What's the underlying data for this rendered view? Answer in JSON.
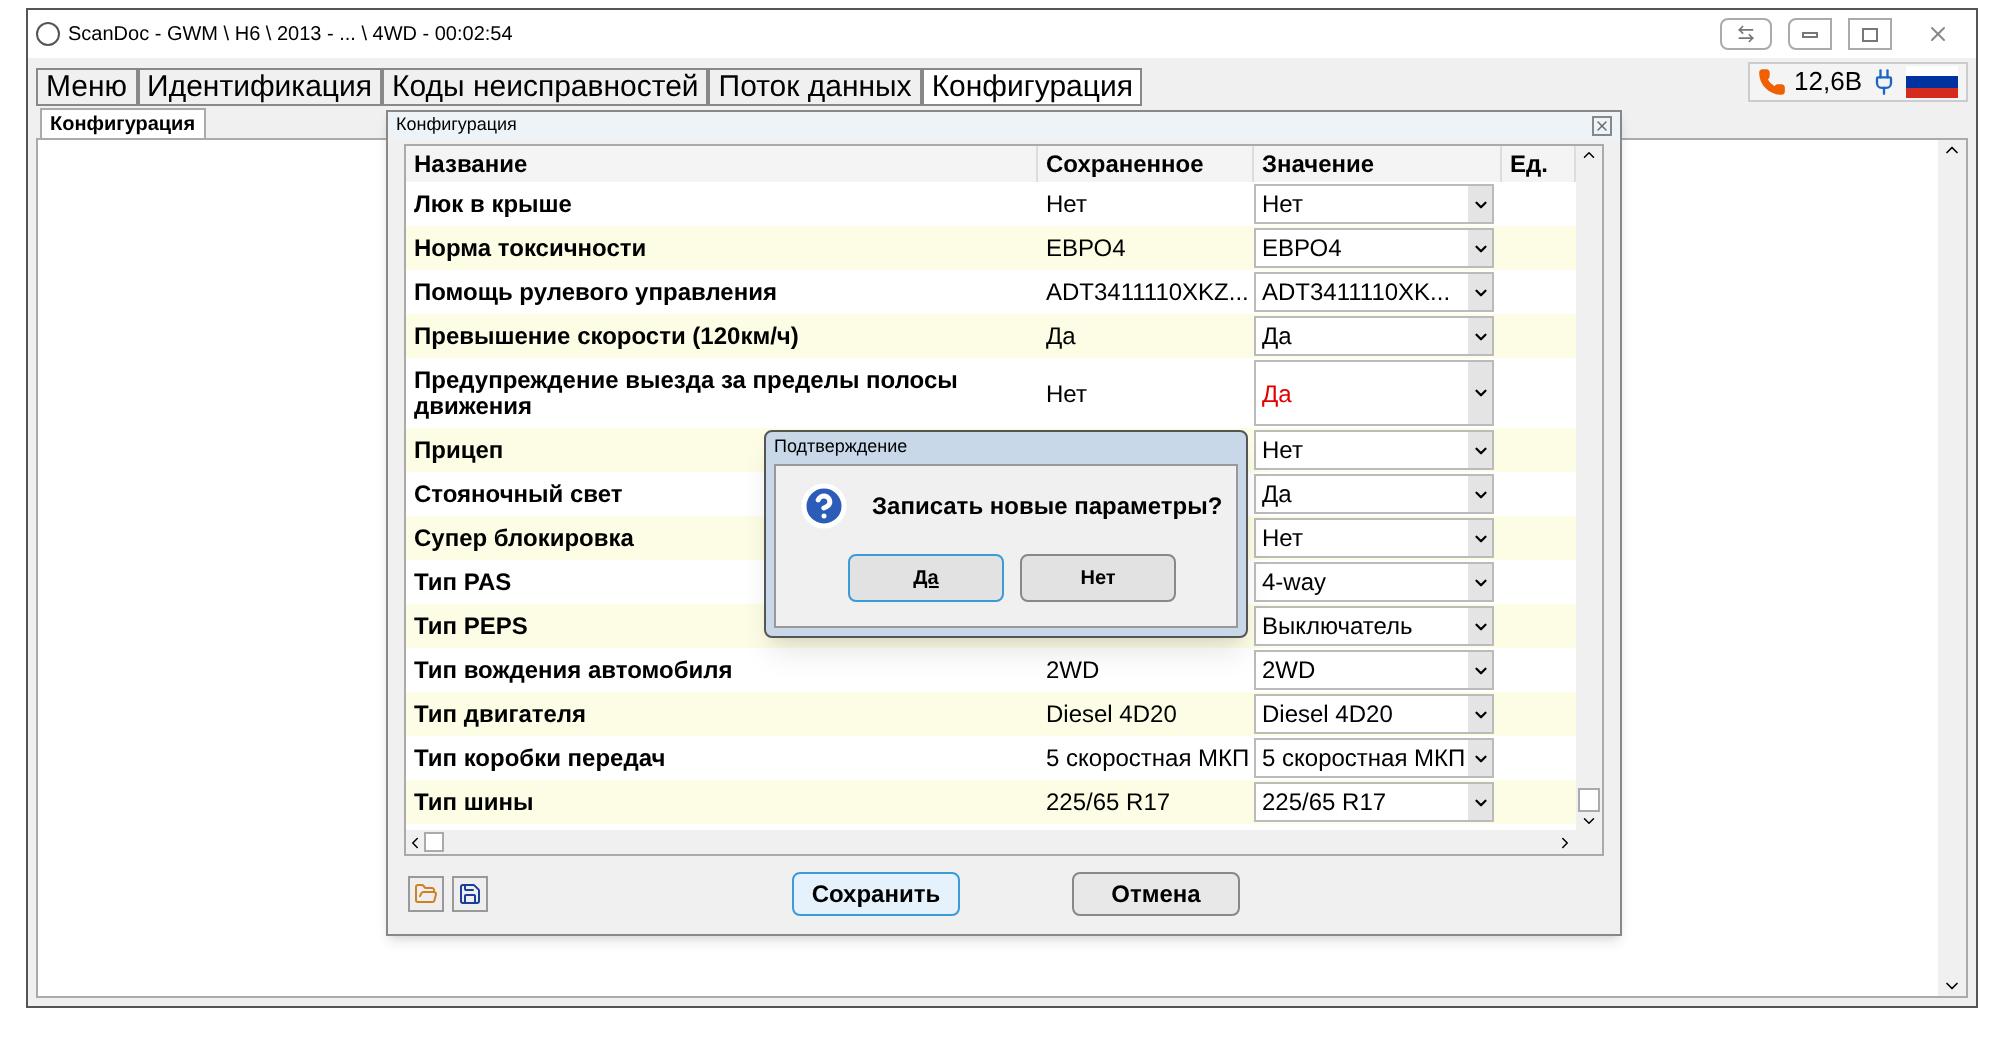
{
  "window": {
    "title": "ScanDoc - GWM \\ H6 \\ 2013 - ... \\ 4WD - 00:02:54"
  },
  "tabs": [
    {
      "label": "Меню",
      "selected": false
    },
    {
      "label": "Идентификация",
      "selected": false
    },
    {
      "label": "Коды неисправностей",
      "selected": false
    },
    {
      "label": "Поток данных",
      "selected": false
    },
    {
      "label": "Конфигурация",
      "selected": true
    }
  ],
  "status": {
    "voltage": "12,6В"
  },
  "subtab": {
    "label": "Конфигурация"
  },
  "config_dialog": {
    "title": "Конфигурация",
    "columns": [
      "Название",
      "Сохраненное",
      "Значение",
      "Ед."
    ],
    "rows": [
      {
        "name": "Люк в крыше",
        "saved": "Нет",
        "value": "Нет",
        "changed": false
      },
      {
        "name": "Норма токсичности",
        "saved": "ЕВРО4",
        "value": "ЕВРО4",
        "changed": false
      },
      {
        "name": "Помощь рулевого управления",
        "saved": "ADT3411110XKZ...",
        "value": "ADT3411110XK...",
        "changed": false
      },
      {
        "name": "Превышение скорости (120км/ч)",
        "saved": "Да",
        "value": "Да",
        "changed": false
      },
      {
        "name": "Предупреждение выезда за пределы полосы движения",
        "saved": "Нет",
        "value": "Да",
        "changed": true
      },
      {
        "name": "Прицеп",
        "value": "Нет",
        "changed": false
      },
      {
        "name": "Стояночный свет",
        "value": "Да",
        "changed": false
      },
      {
        "name": "Супер блокировка",
        "value": "Нет",
        "changed": false
      },
      {
        "name": "Тип PAS",
        "value": "4-way",
        "changed": false
      },
      {
        "name": "Тип PEPS",
        "value": "Выключатель",
        "changed": false
      },
      {
        "name": "Тип вождения автомобиля",
        "saved": "2WD",
        "value": "2WD",
        "changed": false
      },
      {
        "name": "Тип двигателя",
        "saved": "Diesel 4D20",
        "value": "Diesel 4D20",
        "changed": false
      },
      {
        "name": "Тип коробки передач",
        "saved": "5 скоростная МКП",
        "value": "5 скоростная МКП",
        "changed": false
      },
      {
        "name": "Тип шины",
        "saved": "225/65 R17",
        "value": "225/65 R17",
        "changed": false
      }
    ],
    "buttons": [
      "Сохранить",
      "Отмена"
    ]
  },
  "confirm_dialog": {
    "title": "Подтверждение",
    "message": "Записать новые параметры?",
    "buttons": [
      "Да",
      "Нет"
    ]
  }
}
